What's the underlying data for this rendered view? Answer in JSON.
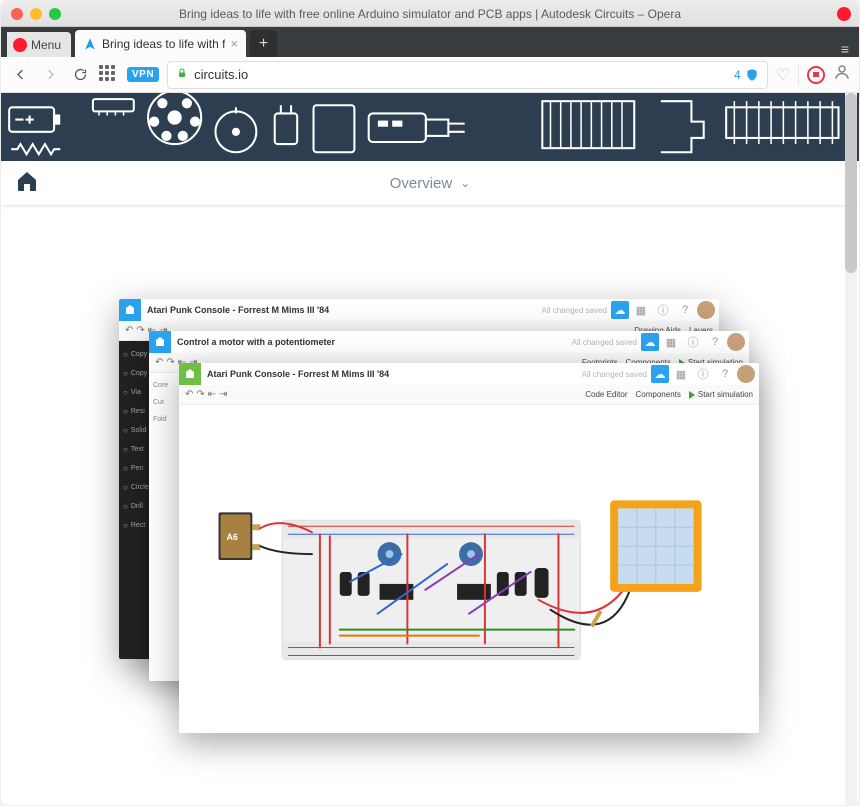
{
  "window": {
    "title": "Bring ideas to life with free online Arduino simulator and PCB apps | Autodesk Circuits – Opera"
  },
  "browser": {
    "menu_label": "Menu",
    "tab_title": "Bring ideas to life with f",
    "new_tab_glyph": "+",
    "vpn_label": "VPN",
    "url": "circuits.io",
    "blocked_count": "4"
  },
  "page": {
    "subnav_label": "Overview"
  },
  "stack": {
    "w1": {
      "title": "Atari Punk Console - Forrest M Mims III '84",
      "saved": "All changed saved",
      "tool_right": [
        "Drawing Aids",
        "Layers"
      ],
      "side_items": [
        "Copy",
        "Copy",
        "Via",
        "Resi",
        "Solid",
        "Text",
        "Pen",
        "Circle",
        "Drill",
        "Rect"
      ]
    },
    "w2": {
      "title": "Control a motor with a potentiometer",
      "saved": "All changed saved",
      "tool_right": [
        "Footprints",
        "Components",
        "Start simulation"
      ],
      "side_items": [
        "Core",
        "Cut",
        "Fold"
      ]
    },
    "w3": {
      "title": "Atari Punk Console - Forrest M Mims III '84",
      "saved": "All changed saved",
      "tool_right": [
        "Code Editor",
        "Components",
        "Start simulation"
      ]
    }
  }
}
